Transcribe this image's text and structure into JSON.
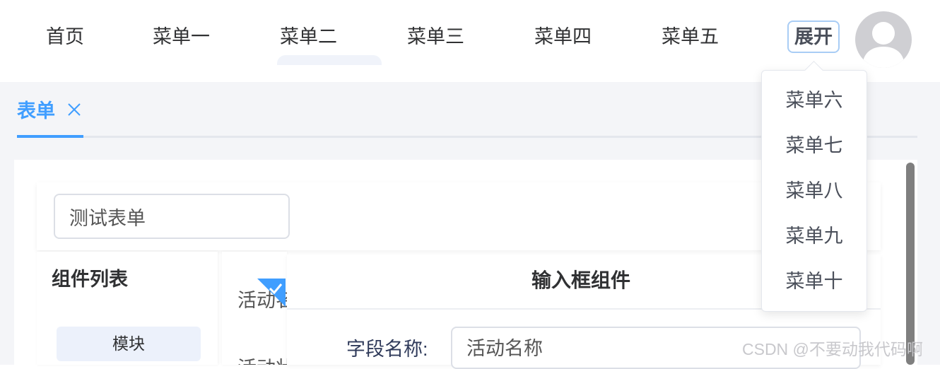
{
  "nav": {
    "items": [
      "首页",
      "菜单一",
      "菜单二",
      "菜单三",
      "菜单四",
      "菜单五"
    ],
    "expand_label": "展开",
    "dropdown": [
      "菜单六",
      "菜单七",
      "菜单八",
      "菜单九",
      "菜单十"
    ]
  },
  "tabs": {
    "active_label": "表单"
  },
  "form": {
    "name_value": "测试表单"
  },
  "components": {
    "title": "组件列表",
    "module_label": "模块"
  },
  "canvas": {
    "item_1": "活动名",
    "item_2": "活动状"
  },
  "properties": {
    "title": "输入框组件",
    "field_label": "字段名称:",
    "field_value": "活动名称"
  },
  "watermark": "CSDN @不要动我代码啊",
  "colors": {
    "accent": "#409eff",
    "expand_border": "#a9cdf5",
    "page_bg": "#f4f5f8"
  }
}
